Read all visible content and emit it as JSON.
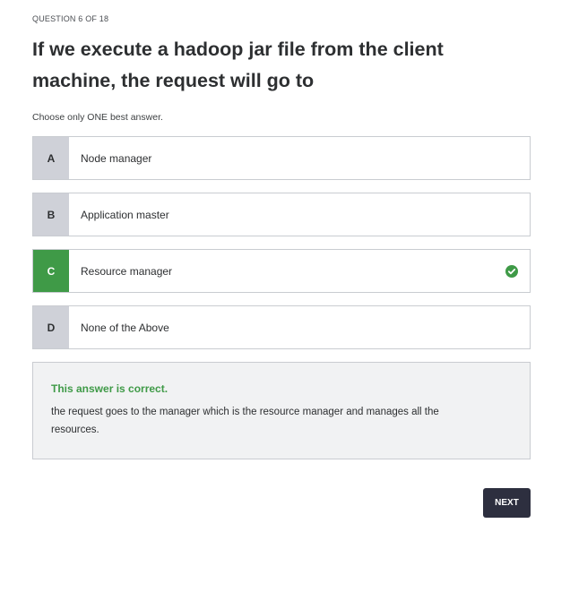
{
  "header": {
    "counter": "QUESTION 6 OF 18"
  },
  "question": {
    "text": "If we execute a hadoop jar file from the client machine, the request will go to",
    "instruction": "Choose only ONE best answer."
  },
  "options": [
    {
      "letter": "A",
      "label": "Node manager",
      "state": "default"
    },
    {
      "letter": "B",
      "label": "Application master",
      "state": "default"
    },
    {
      "letter": "C",
      "label": "Resource manager",
      "state": "correct",
      "icon": "check-circle-icon"
    },
    {
      "letter": "D",
      "label": "None of the Above",
      "state": "default"
    }
  ],
  "feedback": {
    "title": "This answer is correct.",
    "body": "the request goes to the manager which is the resource manager and manages all the resources."
  },
  "actions": {
    "next_label": "NEXT"
  },
  "colors": {
    "correct": "#3f9a47",
    "letter_bg": "#cfd1d8",
    "button_bg": "#2d2f3f",
    "feedback_bg": "#f1f2f3"
  }
}
